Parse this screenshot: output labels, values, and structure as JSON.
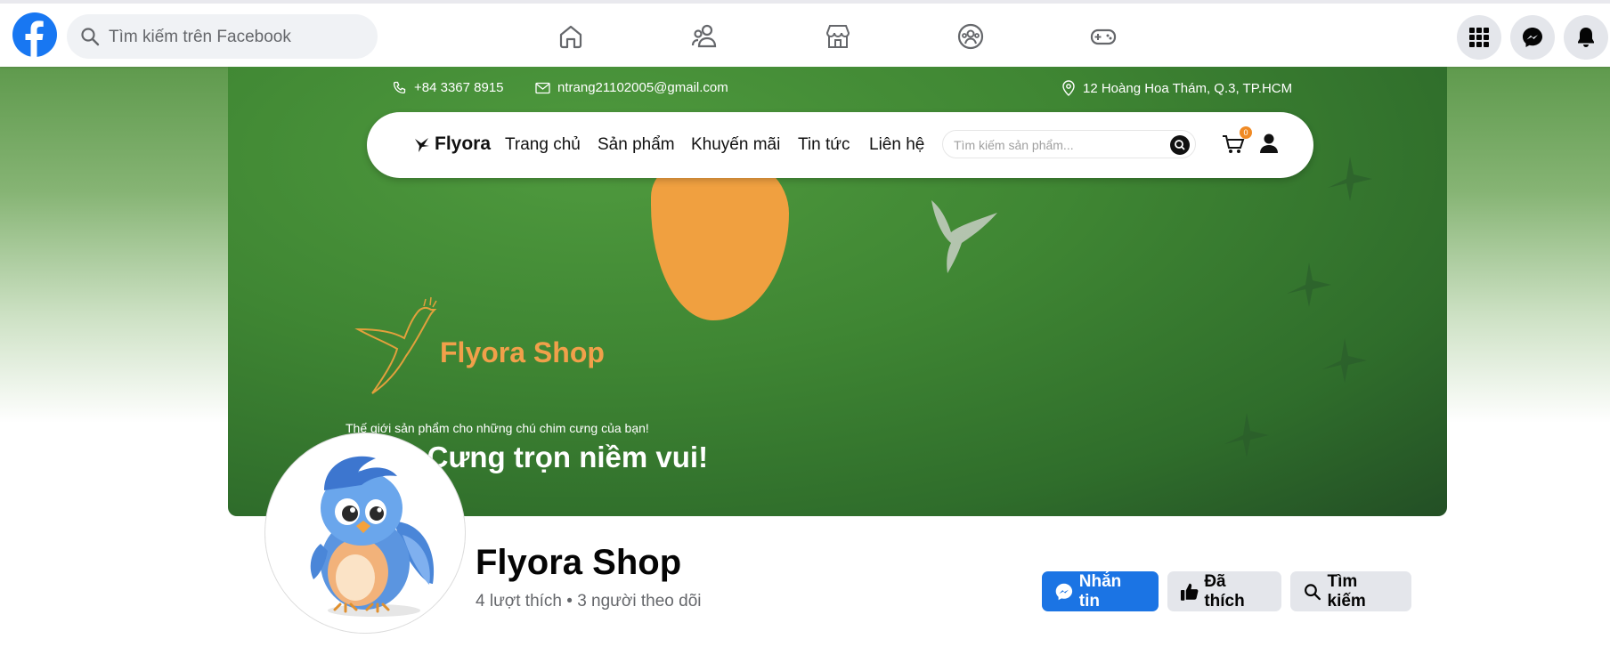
{
  "topbar": {
    "search_placeholder": "Tìm kiếm trên Facebook",
    "nav_tabs": [
      "home-icon",
      "friends-icon",
      "marketplace-icon",
      "groups-icon",
      "gaming-icon"
    ],
    "right_buttons": [
      "menu-grid-icon",
      "messenger-icon",
      "notifications-icon"
    ],
    "brand_color": "#1877f2"
  },
  "cover": {
    "phone": "+84 3367 8915",
    "email": "ntrang21102005@gmail.com",
    "address": "12 Hoàng Hoa Thám, Q.3, TP.HCM",
    "menu": {
      "brand": "Flyora",
      "links": [
        "Trang chủ",
        "Sản phẩm",
        "Khuyến mãi",
        "Tin tức",
        "Liên hệ"
      ],
      "search_placeholder": "Tìm kiếm sản phẩm...",
      "cart_count": "0"
    },
    "shop_title": "Flyora Shop",
    "tagline": "Thế giới sản phẩm cho những chú chim cưng của bạn!",
    "headline": "Chim Cưng trọn niềm vui!",
    "accent_color": "#f0a040",
    "background_color": "#3f8633"
  },
  "profile": {
    "name": "Flyora Shop",
    "stats": "4 lượt thích • 3 người theo dõi",
    "buttons": {
      "message": "Nhắn tin",
      "liked": "Đã thích",
      "search": "Tìm kiếm"
    }
  }
}
